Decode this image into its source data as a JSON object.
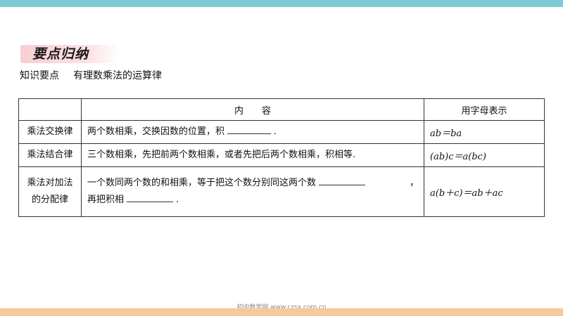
{
  "section": {
    "title": "要点归纳"
  },
  "topic": {
    "label": "知识要点",
    "title": "有理数乘法的运算律"
  },
  "table": {
    "headers": [
      "",
      "内　　容",
      "用字母表示"
    ],
    "rows": [
      {
        "name": "乘法交换律",
        "content_before": "两个数相乘，交换因数的位置，积",
        "content_after": ".",
        "formula": "ab＝ba"
      },
      {
        "name": "乘法结合律",
        "content": "三个数相乘，先把前两个数相乘，或者先把后两个数相乘，积相等.",
        "formula": "(ab)c＝a(bc)"
      },
      {
        "name_line1": "乘法对加法",
        "name_line2": "的分配律",
        "content_line1": "一个数同两个数的和相乘，等于把这个数分别同这两个数",
        "content_line1_end": "，",
        "content_line2_before": "再把积相",
        "content_line2_after": ".",
        "formula": "a(b＋c)＝ab＋ac"
      }
    ]
  },
  "footer": {
    "watermark": "初中数学网 www.czsx.com.cn"
  },
  "colors": {
    "top_bar": "#7ccbd6",
    "bottom_bar": "#f5c99a",
    "badge": "#f8cfd3"
  }
}
